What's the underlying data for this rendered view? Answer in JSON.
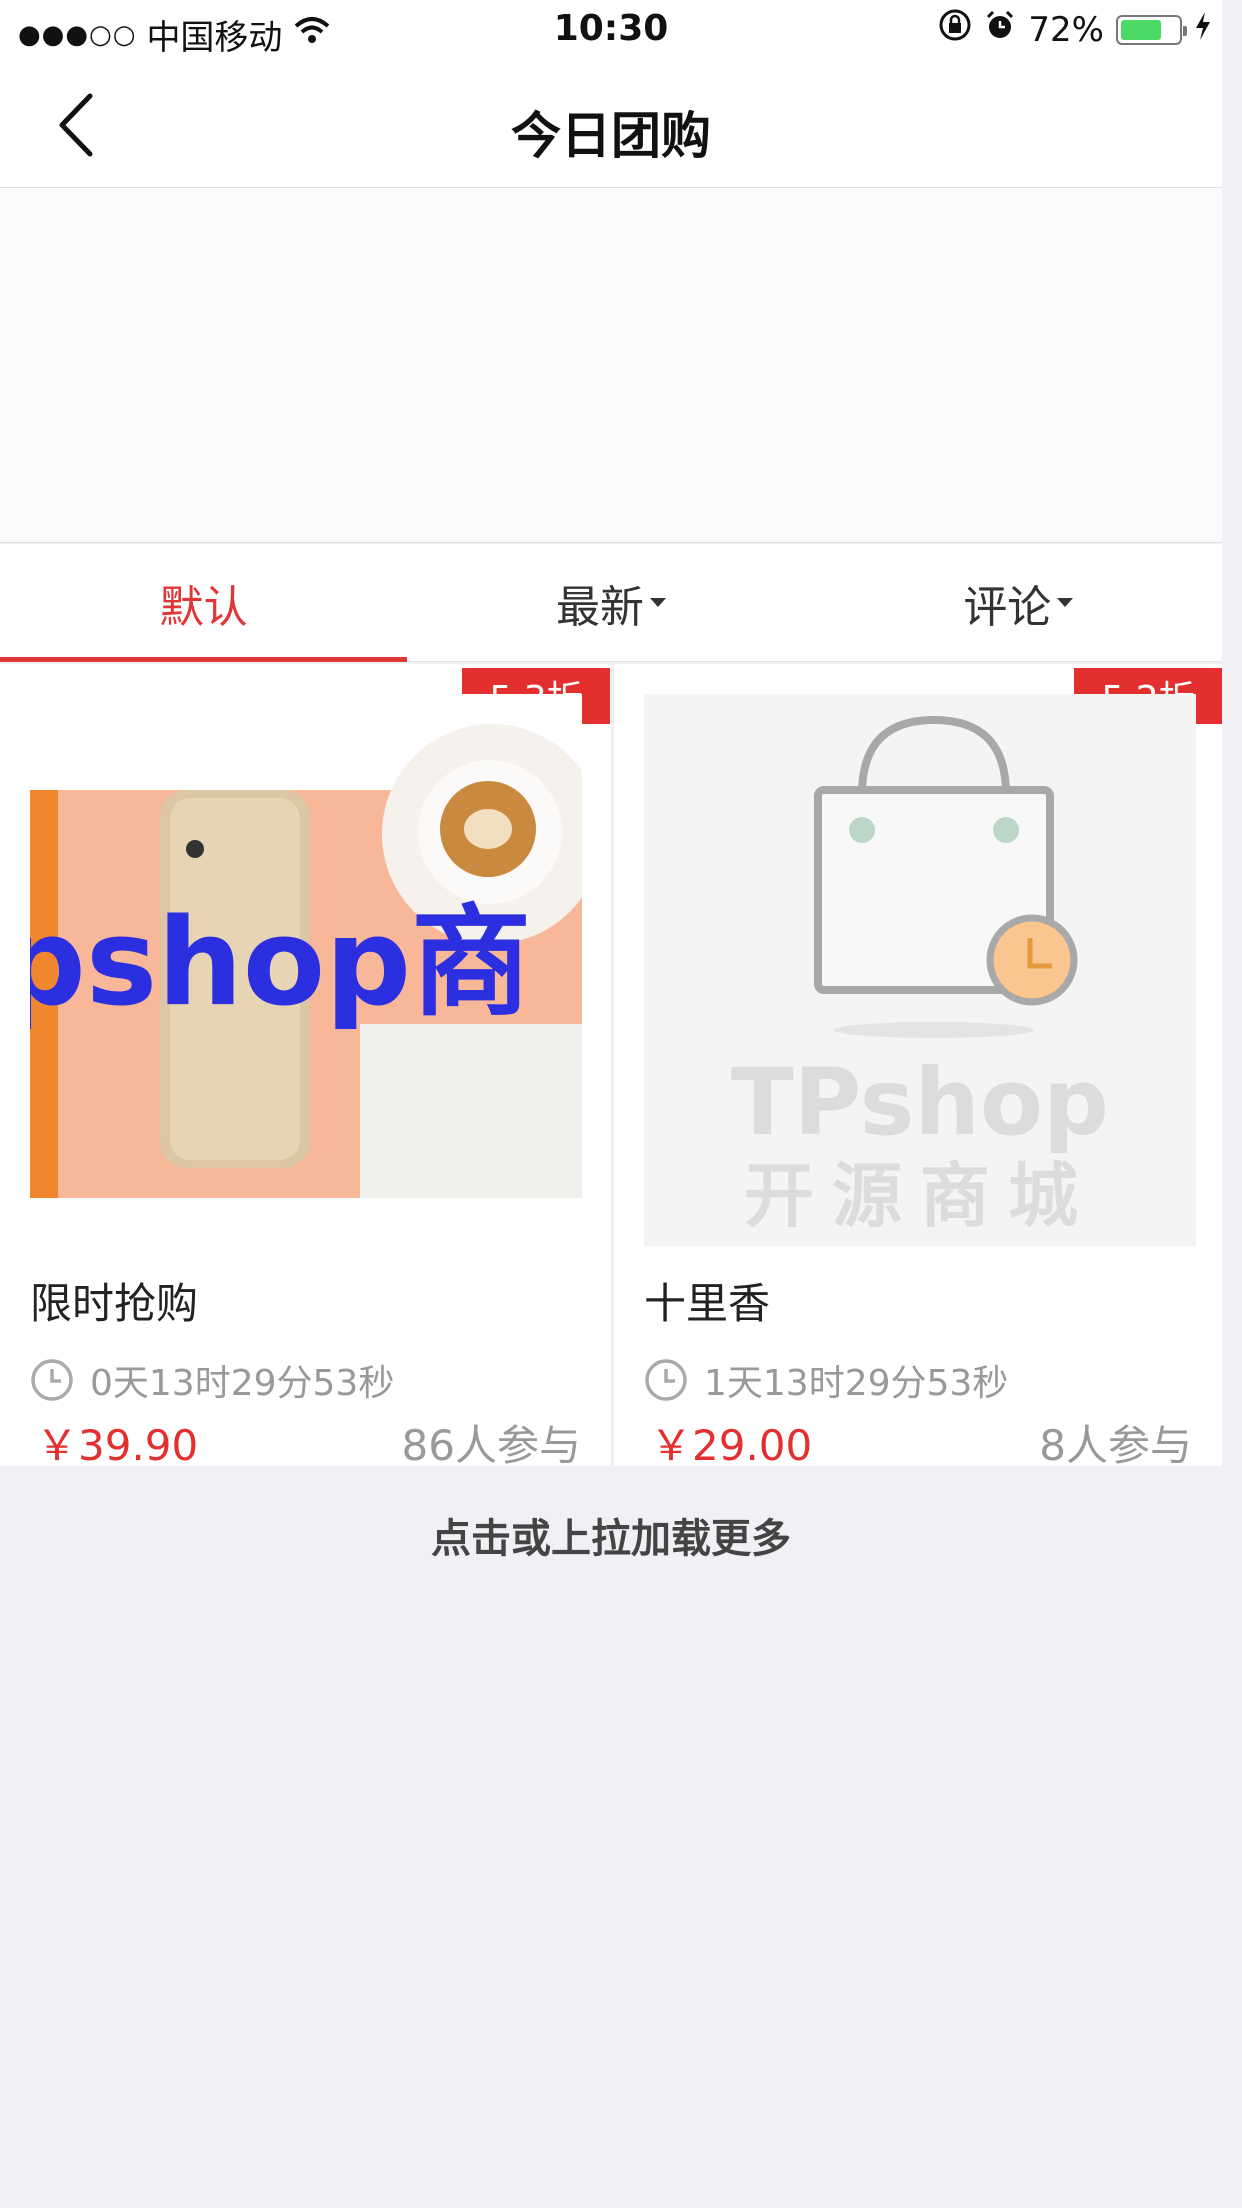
{
  "status_bar": {
    "signal": "●●●○○",
    "carrier": "中国移动",
    "time": "10:30",
    "battery_percent": "72%",
    "battery_level": 0.72,
    "icons": [
      "wifi-icon",
      "rotation-lock-icon",
      "alarm-icon",
      "battery-icon",
      "charging-icon"
    ]
  },
  "nav": {
    "title": "今日团购",
    "back_icon": "back-chevron-icon"
  },
  "tabs": [
    {
      "label": "默认",
      "active": true
    },
    {
      "label": "最新",
      "active": false,
      "has_caret": true
    },
    {
      "label": "评论",
      "active": false,
      "has_caret": true
    }
  ],
  "products": [
    {
      "discount": "5.3折",
      "name": "限时抢购",
      "countdown": "0天13时29分53秒",
      "price": "￥39.90",
      "participants": "86人参与",
      "image_text": "pshop商"
    },
    {
      "discount": "5.2折",
      "name": "十里香",
      "countdown": "1天13时29分53秒",
      "price": "￥29.00",
      "participants": "8人参与",
      "image_text_1": "TPshop",
      "image_text_2": "开源商城"
    }
  ],
  "load_more": "点击或上拉加载更多",
  "colors": {
    "accent": "#e3302f",
    "background": "#f0f1f5",
    "muted": "#999999",
    "battery": "#4cd964"
  }
}
